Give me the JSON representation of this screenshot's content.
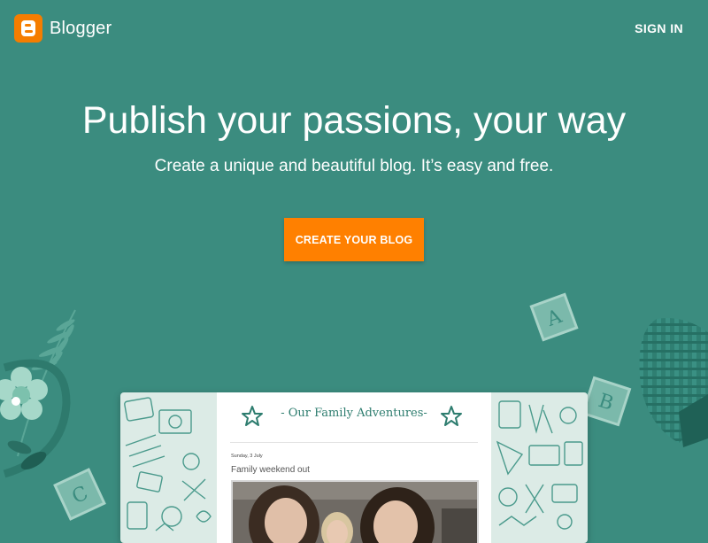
{
  "header": {
    "logo_text": "Blogger",
    "sign_in": "SIGN IN"
  },
  "hero": {
    "title": "Publish your passions, your way",
    "subtitle": "Create a unique and beautiful blog. It’s easy and free.",
    "cta": "CREATE YOUR BLOG"
  },
  "preview": {
    "blog_title": "- Our Family Adventures-",
    "post_date": "Sunday, 3 July",
    "post_title": "Family weekend out"
  },
  "decor": {
    "blocks": [
      "A",
      "B",
      "C"
    ]
  },
  "colors": {
    "background": "#3b8c7f",
    "accent": "#ff8000",
    "brand": "#f57d00"
  }
}
